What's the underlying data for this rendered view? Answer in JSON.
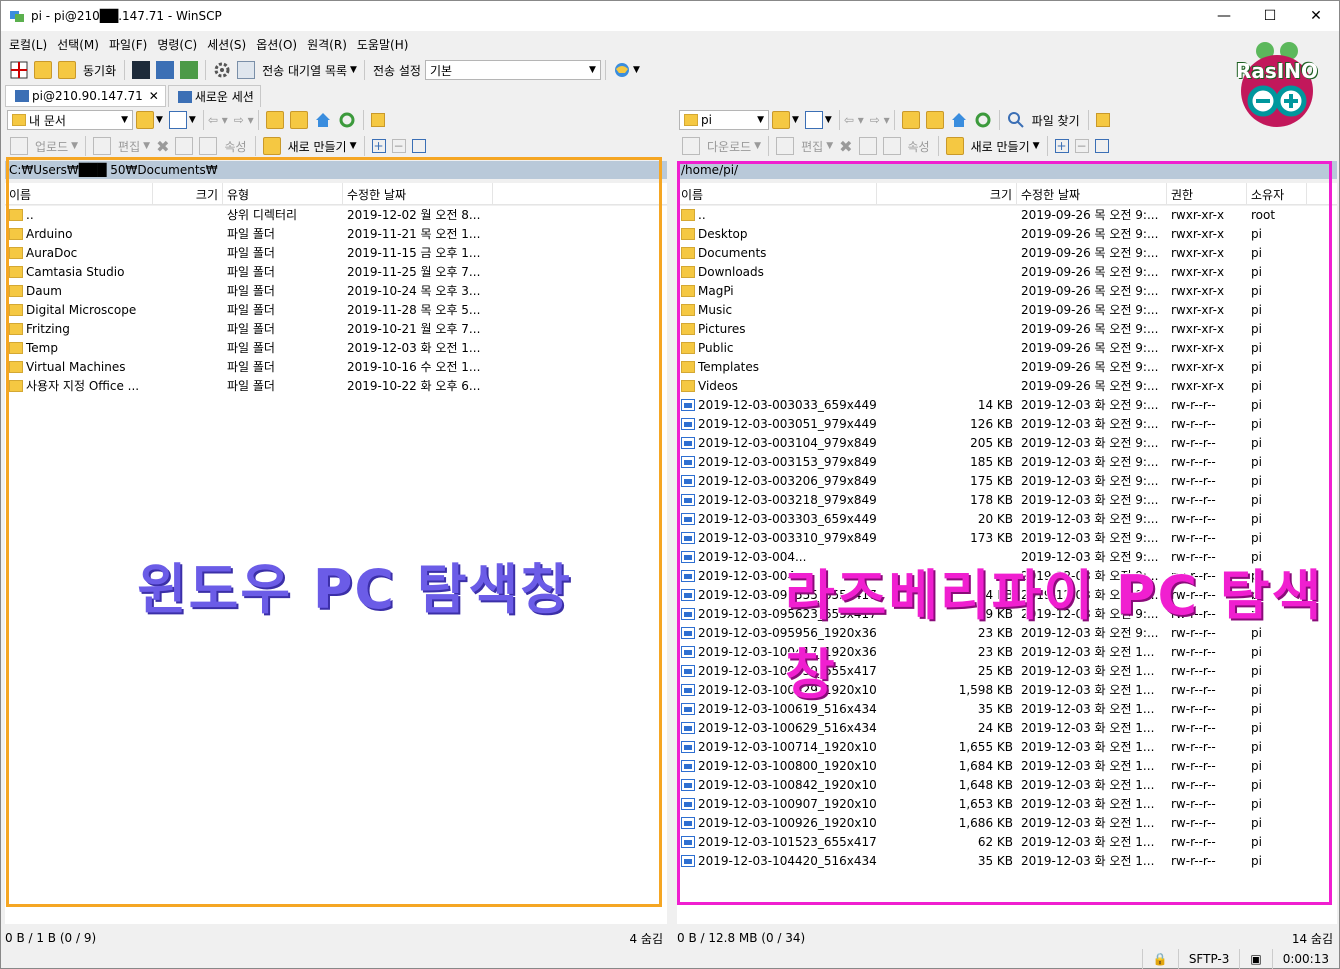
{
  "window": {
    "title": "pi - pi@210██.147.71 - WinSCP"
  },
  "menu": [
    "로컬(L)",
    "선택(M)",
    "파일(F)",
    "명령(C)",
    "세션(S)",
    "옵션(O)",
    "원격(R)",
    "도움말(H)"
  ],
  "toolbar": {
    "sync_label": "동기화",
    "queue_label": "전송 대기열 목록",
    "transfer_settings_label": "전송 설정",
    "transfer_preset": "기본"
  },
  "tabs": {
    "session": "pi@210.90.147.71",
    "new_session": "새로운 세션"
  },
  "local": {
    "drive": "내 문서",
    "upload": "업로드",
    "edit": "편집",
    "props": "속성",
    "new": "새로 만들기",
    "path": "C:₩Users₩███ 50₩Documents₩",
    "columns": [
      "이름",
      "크기",
      "유형",
      "수정한 날짜"
    ],
    "rows": [
      {
        "name": "..",
        "size": "",
        "type": "상위 디렉터리",
        "date": "2019-12-02 월  오전 8..."
      },
      {
        "name": "Arduino",
        "size": "",
        "type": "파일 폴더",
        "date": "2019-11-21 목  오전 1..."
      },
      {
        "name": "AuraDoc",
        "size": "",
        "type": "파일 폴더",
        "date": "2019-11-15 금  오후 1..."
      },
      {
        "name": "Camtasia Studio",
        "size": "",
        "type": "파일 폴더",
        "date": "2019-11-25 월  오후 7..."
      },
      {
        "name": "Daum",
        "size": "",
        "type": "파일 폴더",
        "date": "2019-10-24 목  오후 3..."
      },
      {
        "name": "Digital Microscope",
        "size": "",
        "type": "파일 폴더",
        "date": "2019-11-28 목  오후 5..."
      },
      {
        "name": "Fritzing",
        "size": "",
        "type": "파일 폴더",
        "date": "2019-10-21 월  오후 7..."
      },
      {
        "name": "Temp",
        "size": "",
        "type": "파일 폴더",
        "date": "2019-12-03 화  오전 1..."
      },
      {
        "name": "Virtual Machines",
        "size": "",
        "type": "파일 폴더",
        "date": "2019-10-16 수  오전 1..."
      },
      {
        "name": "사용자 지정 Office ...",
        "size": "",
        "type": "파일 폴더",
        "date": "2019-10-22 화  오후 6..."
      }
    ],
    "status_left": "0 B / 1 B (0 / 9)",
    "status_right": "4 숨김"
  },
  "remote": {
    "drive": "pi",
    "download": "다운로드",
    "edit": "편집",
    "props": "속성",
    "new": "새로 만들기",
    "find": "파일 찾기",
    "path": "/home/pi/",
    "columns": [
      "이름",
      "크기",
      "수정한 날짜",
      "권한",
      "소유자"
    ],
    "rows": [
      {
        "name": "..",
        "size": "",
        "date": "2019-09-26 목 오전 9:...",
        "perm": "rwxr-xr-x",
        "owner": "root",
        "kind": "up"
      },
      {
        "name": "Desktop",
        "size": "",
        "date": "2019-09-26 목 오전 9:...",
        "perm": "rwxr-xr-x",
        "owner": "pi",
        "kind": "f"
      },
      {
        "name": "Documents",
        "size": "",
        "date": "2019-09-26 목 오전 9:...",
        "perm": "rwxr-xr-x",
        "owner": "pi",
        "kind": "f"
      },
      {
        "name": "Downloads",
        "size": "",
        "date": "2019-09-26 목 오전 9:...",
        "perm": "rwxr-xr-x",
        "owner": "pi",
        "kind": "f"
      },
      {
        "name": "MagPi",
        "size": "",
        "date": "2019-09-26 목 오전 9:...",
        "perm": "rwxr-xr-x",
        "owner": "pi",
        "kind": "f"
      },
      {
        "name": "Music",
        "size": "",
        "date": "2019-09-26 목 오전 9:...",
        "perm": "rwxr-xr-x",
        "owner": "pi",
        "kind": "f"
      },
      {
        "name": "Pictures",
        "size": "",
        "date": "2019-09-26 목 오전 9:...",
        "perm": "rwxr-xr-x",
        "owner": "pi",
        "kind": "f"
      },
      {
        "name": "Public",
        "size": "",
        "date": "2019-09-26 목 오전 9:...",
        "perm": "rwxr-xr-x",
        "owner": "pi",
        "kind": "f"
      },
      {
        "name": "Templates",
        "size": "",
        "date": "2019-09-26 목 오전 9:...",
        "perm": "rwxr-xr-x",
        "owner": "pi",
        "kind": "f"
      },
      {
        "name": "Videos",
        "size": "",
        "date": "2019-09-26 목 오전 9:...",
        "perm": "rwxr-xr-x",
        "owner": "pi",
        "kind": "f"
      },
      {
        "name": "2019-12-03-003033_659x449...",
        "size": "14 KB",
        "date": "2019-12-03 화 오전 9:...",
        "perm": "rw-r--r--",
        "owner": "pi",
        "kind": "img"
      },
      {
        "name": "2019-12-03-003051_979x449...",
        "size": "126 KB",
        "date": "2019-12-03 화 오전 9:...",
        "perm": "rw-r--r--",
        "owner": "pi",
        "kind": "img"
      },
      {
        "name": "2019-12-03-003104_979x849...",
        "size": "205 KB",
        "date": "2019-12-03 화 오전 9:...",
        "perm": "rw-r--r--",
        "owner": "pi",
        "kind": "img"
      },
      {
        "name": "2019-12-03-003153_979x849...",
        "size": "185 KB",
        "date": "2019-12-03 화 오전 9:...",
        "perm": "rw-r--r--",
        "owner": "pi",
        "kind": "img"
      },
      {
        "name": "2019-12-03-003206_979x849...",
        "size": "175 KB",
        "date": "2019-12-03 화 오전 9:...",
        "perm": "rw-r--r--",
        "owner": "pi",
        "kind": "img"
      },
      {
        "name": "2019-12-03-003218_979x849...",
        "size": "178 KB",
        "date": "2019-12-03 화 오전 9:...",
        "perm": "rw-r--r--",
        "owner": "pi",
        "kind": "img"
      },
      {
        "name": "2019-12-03-003303_659x449...",
        "size": "20 KB",
        "date": "2019-12-03 화 오전 9:...",
        "perm": "rw-r--r--",
        "owner": "pi",
        "kind": "img"
      },
      {
        "name": "2019-12-03-003310_979x849...",
        "size": "173 KB",
        "date": "2019-12-03 화 오전 9:...",
        "perm": "rw-r--r--",
        "owner": "pi",
        "kind": "img"
      },
      {
        "name": "2019-12-03-004...",
        "size": "",
        "date": "2019-12-03 화 오전 9:...",
        "perm": "rw-r--r--",
        "owner": "pi",
        "kind": "img"
      },
      {
        "name": "2019-12-03-004...",
        "size": "",
        "date": "2019-12-03 화 오전 9:...",
        "perm": "rw-r--r--",
        "owner": "pi",
        "kind": "img"
      },
      {
        "name": "2019-12-03-095555_655x417...",
        "size": "4 KB",
        "date": "2019-12-03 화 오전 9:...",
        "perm": "rw-r--r--",
        "owner": "pi",
        "kind": "img"
      },
      {
        "name": "2019-12-03-095623_655x417...",
        "size": "19 KB",
        "date": "2019-12-03 화 오전 9:...",
        "perm": "rw-r--r--",
        "owner": "pi",
        "kind": "img"
      },
      {
        "name": "2019-12-03-095956_1920x36...",
        "size": "23 KB",
        "date": "2019-12-03 화 오전 9:...",
        "perm": "rw-r--r--",
        "owner": "pi",
        "kind": "img"
      },
      {
        "name": "2019-12-03-100417_1920x36...",
        "size": "23 KB",
        "date": "2019-12-03 화 오전 1...",
        "perm": "rw-r--r--",
        "owner": "pi",
        "kind": "img"
      },
      {
        "name": "2019-12-03-100439_655x417...",
        "size": "25 KB",
        "date": "2019-12-03 화 오전 1...",
        "perm": "rw-r--r--",
        "owner": "pi",
        "kind": "img"
      },
      {
        "name": "2019-12-03-100529_1920x10...",
        "size": "1,598 KB",
        "date": "2019-12-03 화 오전 1...",
        "perm": "rw-r--r--",
        "owner": "pi",
        "kind": "img"
      },
      {
        "name": "2019-12-03-100619_516x434...",
        "size": "35 KB",
        "date": "2019-12-03 화 오전 1...",
        "perm": "rw-r--r--",
        "owner": "pi",
        "kind": "img"
      },
      {
        "name": "2019-12-03-100629_516x434...",
        "size": "24 KB",
        "date": "2019-12-03 화 오전 1...",
        "perm": "rw-r--r--",
        "owner": "pi",
        "kind": "img"
      },
      {
        "name": "2019-12-03-100714_1920x10...",
        "size": "1,655 KB",
        "date": "2019-12-03 화 오전 1...",
        "perm": "rw-r--r--",
        "owner": "pi",
        "kind": "img"
      },
      {
        "name": "2019-12-03-100800_1920x10...",
        "size": "1,684 KB",
        "date": "2019-12-03 화 오전 1...",
        "perm": "rw-r--r--",
        "owner": "pi",
        "kind": "img"
      },
      {
        "name": "2019-12-03-100842_1920x10...",
        "size": "1,648 KB",
        "date": "2019-12-03 화 오전 1...",
        "perm": "rw-r--r--",
        "owner": "pi",
        "kind": "img"
      },
      {
        "name": "2019-12-03-100907_1920x10...",
        "size": "1,653 KB",
        "date": "2019-12-03 화 오전 1...",
        "perm": "rw-r--r--",
        "owner": "pi",
        "kind": "img"
      },
      {
        "name": "2019-12-03-100926_1920x10...",
        "size": "1,686 KB",
        "date": "2019-12-03 화 오전 1...",
        "perm": "rw-r--r--",
        "owner": "pi",
        "kind": "img"
      },
      {
        "name": "2019-12-03-101523_655x417...",
        "size": "62 KB",
        "date": "2019-12-03 화 오전 1...",
        "perm": "rw-r--r--",
        "owner": "pi",
        "kind": "img"
      },
      {
        "name": "2019-12-03-104420_516x434...",
        "size": "35 KB",
        "date": "2019-12-03 화 오전 1...",
        "perm": "rw-r--r--",
        "owner": "pi",
        "kind": "img"
      }
    ],
    "status_left": "0 B / 12.8 MB (0 / 34)",
    "status_right": "14 숨김"
  },
  "statusbar": {
    "protocol": "SFTP-3",
    "time": "0:00:13"
  },
  "annotations": {
    "left": "윈도우 PC 탐색창",
    "right": "라즈베리파이 PC 탐색창"
  },
  "logo_text": "RasINO",
  "colors": {
    "highlight_left": "#f5a623",
    "highlight_right": "#f01fd0",
    "path_bar": "#b9c9d9"
  }
}
